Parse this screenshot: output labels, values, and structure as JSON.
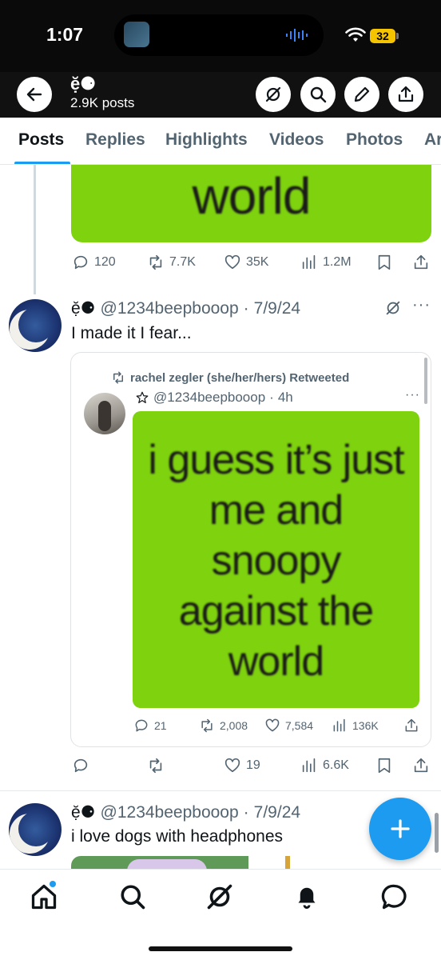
{
  "status_bar": {
    "time": "1:07",
    "battery": "32"
  },
  "header": {
    "name": "ẹ̆⚈",
    "posts_count": "2.9K posts"
  },
  "tabs": [
    "Posts",
    "Replies",
    "Highlights",
    "Videos",
    "Photos",
    "Ar"
  ],
  "top_post": {
    "meme_text": "world",
    "replies": "120",
    "reposts": "7.7K",
    "likes": "35K",
    "views": "1.2M"
  },
  "post1": {
    "author_glyph": "ẹ̆⚈",
    "handle": "@1234beepbooop",
    "date": "7/9/24",
    "text": "I made it I fear...",
    "quote": {
      "retweeted_by": "rachel zegler (she/her/hers) Retweeted",
      "handle": "@1234beepbooop",
      "time": "4h",
      "meme_lines": [
        "i guess it’s just",
        "me and",
        "snoopy",
        "against the",
        "world"
      ],
      "replies": "21",
      "reposts": "2,008",
      "likes": "7,584",
      "views": "136K"
    },
    "likes": "19",
    "views": "6.6K"
  },
  "post2": {
    "author_glyph": "ẹ̆⚈",
    "handle": "@1234beepbooop",
    "date": "7/9/24",
    "text": "i love dogs with headphones"
  },
  "icons": {
    "back": "arrow-left-icon",
    "grok": "grok-icon",
    "search": "search-icon",
    "edit": "pencil-icon",
    "share": "share-icon",
    "compose": "plus-icon"
  },
  "colors": {
    "accent": "#1d9bf0",
    "meme_green": "#7ed20e",
    "header_bg": "#111111"
  }
}
